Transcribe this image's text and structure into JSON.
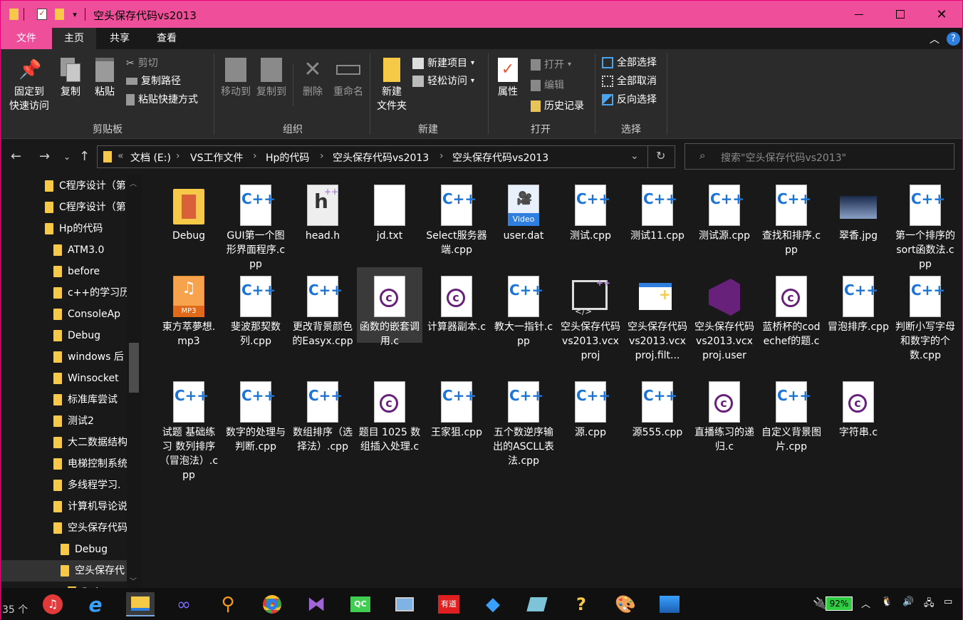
{
  "window": {
    "title": "空头保存代码vs2013"
  },
  "ribbon_tabs": [
    "文件",
    "主页",
    "共享",
    "查看"
  ],
  "ribbon": {
    "clipboard": {
      "pin": "固定到\n快速访问",
      "pin_l1": "固定到",
      "pin_l2": "快速访问",
      "copy": "复制",
      "paste": "粘贴",
      "cut": "剪切",
      "copy_path": "复制路径",
      "paste_shortcut": "粘贴快捷方式",
      "label": "剪贴板"
    },
    "organize": {
      "move_to": "移动到",
      "copy_to": "复制到",
      "delete": "删除",
      "rename": "重命名",
      "label": "组织"
    },
    "new": {
      "new_folder_l1": "新建",
      "new_folder_l2": "文件夹",
      "new_item": "新建项目",
      "easy_access": "轻松访问",
      "label": "新建"
    },
    "open": {
      "properties": "属性",
      "open": "打开",
      "edit": "编辑",
      "history": "历史记录",
      "label": "打开"
    },
    "select": {
      "select_all": "全部选择",
      "select_none": "全部取消",
      "invert": "反向选择",
      "label": "选择"
    }
  },
  "address": {
    "chevron": "«",
    "crumbs": [
      "文档 (E:)",
      "VS工作文件",
      "Hp的代码",
      "空头保存代码vs2013",
      "空头保存代码vs2013"
    ]
  },
  "search": {
    "placeholder": "搜索\"空头保存代码vs2013\""
  },
  "nav_tree": [
    "C程序设计（第",
    "C程序设计（第",
    "Hp的代码",
    "ATM3.0",
    "before",
    "c++的学习历",
    "ConsoleAp",
    "Debug",
    "windows 后",
    "Winsocket",
    "标准库尝试",
    "测试2",
    "大二数据结构",
    "电梯控制系统",
    "多线程学习.",
    "计算机导论说",
    "空头保存代码",
    "Debug",
    "空头保存代",
    "Debug"
  ],
  "files_row1": [
    {
      "name": "Debug",
      "type": "folder"
    },
    {
      "name": "GUI第一个图形界面程序.cpp",
      "type": "cpp"
    },
    {
      "name": "head.h",
      "type": "h"
    },
    {
      "name": "jd.txt",
      "type": "txt"
    },
    {
      "name": "Select服务器端.cpp",
      "type": "cpp"
    },
    {
      "name": "user.dat",
      "type": "video"
    },
    {
      "name": "测试.cpp",
      "type": "cpp"
    },
    {
      "name": "测试11.cpp",
      "type": "cpp"
    },
    {
      "name": "测试源.cpp",
      "type": "cpp"
    },
    {
      "name": "查找和排序.cpp",
      "type": "cpp"
    },
    {
      "name": "翠香.jpg",
      "type": "jpg"
    },
    {
      "name": "第一个排序的sort函数法.cpp",
      "type": "cpp"
    }
  ],
  "files_row2": [
    {
      "name": "東方萃夢想.mp3",
      "type": "mp3"
    },
    {
      "name": "斐波那契数列.cpp",
      "type": "cpp"
    },
    {
      "name": "更改背景颜色的Easyx.cpp",
      "type": "cpp"
    },
    {
      "name": "函数的嵌套调用.c",
      "type": "c"
    },
    {
      "name": "计算器副本.c",
      "type": "c"
    },
    {
      "name": "教大一指针.cpp",
      "type": "cpp"
    },
    {
      "name": "空头保存代码vs2013.vcxproj",
      "type": "vcxproj"
    },
    {
      "name": "空头保存代码vs2013.vcxproj.filt...",
      "type": "filters"
    },
    {
      "name": "空头保存代码vs2013.vcxproj.user",
      "type": "vs"
    },
    {
      "name": "蓝桥杯的codechef的题.c",
      "type": "c"
    },
    {
      "name": "冒泡排序.cpp",
      "type": "cpp"
    },
    {
      "name": "判断小写字母和数字的个数.cpp",
      "type": "cpp"
    }
  ],
  "files_row3": [
    {
      "name": "试题 基础练习 数列排序（冒泡法）.cpp",
      "type": "cpp"
    },
    {
      "name": "数字的处理与判断.cpp",
      "type": "cpp"
    },
    {
      "name": "数组排序（选择法）.cpp",
      "type": "cpp"
    },
    {
      "name": "题目 1025 数组插入处理.c",
      "type": "c"
    },
    {
      "name": "王家狙.cpp",
      "type": "cpp"
    },
    {
      "name": "五个数逆序输出的ASCLL表法.cpp",
      "type": "cpp"
    },
    {
      "name": "源.cpp",
      "type": "cpp"
    },
    {
      "name": "源555.cpp",
      "type": "cpp"
    },
    {
      "name": "直播练习的递归.c",
      "type": "c"
    },
    {
      "name": "自定义背景图片.cpp",
      "type": "cpp"
    },
    {
      "name": "字符串.c",
      "type": "c"
    }
  ],
  "status": {
    "count": "35 个"
  },
  "tray": {
    "battery": "92%"
  },
  "colors": {
    "accent": "#ef4f9a",
    "background": "#191919",
    "ribbon": "#2b2b2b",
    "folder": "#f7c948",
    "cpp": "#1c74d6",
    "c": "#68217a"
  }
}
